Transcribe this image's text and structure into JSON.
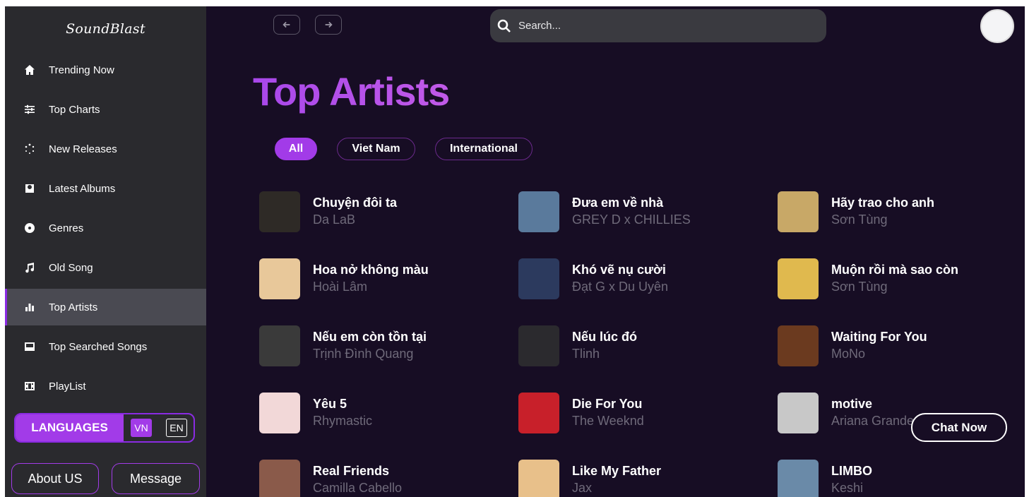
{
  "app": {
    "logo": "SoundBlast"
  },
  "sidebar": {
    "items": [
      {
        "label": "Trending Now",
        "icon": "home-icon",
        "active": false
      },
      {
        "label": "Top Charts",
        "icon": "sliders-icon",
        "active": false
      },
      {
        "label": "New Releases",
        "icon": "spinner-icon",
        "active": false
      },
      {
        "label": "Latest Albums",
        "icon": "album-icon",
        "active": false
      },
      {
        "label": "Genres",
        "icon": "record-icon",
        "active": false
      },
      {
        "label": "Old Song",
        "icon": "music-note-icon",
        "active": false
      },
      {
        "label": "Top Artists",
        "icon": "bar-chart-icon",
        "active": true
      },
      {
        "label": "Top Searched Songs",
        "icon": "keyboard-icon",
        "active": false
      },
      {
        "label": "PlayList",
        "icon": "film-icon",
        "active": false
      }
    ],
    "languages": {
      "label": "LANGUAGES",
      "vn": "VN",
      "en": "EN",
      "selected": "VN"
    },
    "about_label": "About US",
    "message_label": "Message"
  },
  "header": {
    "search_placeholder": "Search..."
  },
  "main": {
    "title": "Top Artists",
    "filters": [
      {
        "label": "All",
        "active": true
      },
      {
        "label": "Viet Nam",
        "active": false
      },
      {
        "label": "International",
        "active": false
      }
    ],
    "songs": [
      {
        "title": "Chuyện đôi ta",
        "artist": "Da LaB",
        "color": "#2e2a26"
      },
      {
        "title": "Đưa em về nhà",
        "artist": "GREY D x CHILLIES",
        "color": "#5a7a9c"
      },
      {
        "title": "Hãy trao cho anh",
        "artist": "Sơn Tùng",
        "color": "#c8a867"
      },
      {
        "title": "Hoa nở không màu",
        "artist": "Hoài Lâm",
        "color": "#e8c89a"
      },
      {
        "title": "Khó vẽ nụ cười",
        "artist": "Đạt G x Du Uyên",
        "color": "#2c3a5e"
      },
      {
        "title": "Muộn rồi mà sao còn",
        "artist": "Sơn Tùng",
        "color": "#e0b94e"
      },
      {
        "title": "Nếu em còn tồn tại",
        "artist": "Trịnh Đình Quang",
        "color": "#3a3a3a"
      },
      {
        "title": "Nếu lúc đó",
        "artist": "Tlinh",
        "color": "#2b2a2e"
      },
      {
        "title": "Waiting For You",
        "artist": "MoNo",
        "color": "#6b3a1f"
      },
      {
        "title": "Yêu 5",
        "artist": "Rhymastic",
        "color": "#f2d8d8"
      },
      {
        "title": "Die For You",
        "artist": "The Weeknd",
        "color": "#c8202a"
      },
      {
        "title": "motive",
        "artist": "Ariana Grande",
        "color": "#c8c8c8"
      },
      {
        "title": "Real Friends",
        "artist": "Camilla Cabello",
        "color": "#8a5a4a"
      },
      {
        "title": "Like My Father",
        "artist": "Jax",
        "color": "#e8c08a"
      },
      {
        "title": "LIMBO",
        "artist": "Keshi",
        "color": "#6a8aa8"
      }
    ]
  },
  "chat": {
    "label": "Chat Now"
  }
}
